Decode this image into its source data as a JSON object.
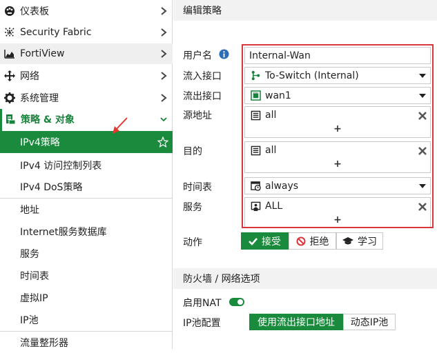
{
  "sidebar": {
    "items": [
      {
        "label": "仪表板"
      },
      {
        "label": "Security Fabric"
      },
      {
        "label": "FortiView"
      },
      {
        "label": "网络"
      },
      {
        "label": "系统管理"
      },
      {
        "label": "策略 & 对象"
      }
    ],
    "sub_items": [
      {
        "label": "IPv4策略"
      },
      {
        "label": "IPv4 访问控制列表"
      },
      {
        "label": "IPv4 DoS策略"
      },
      {
        "label": "地址"
      },
      {
        "label": "Internet服务数据库"
      },
      {
        "label": "服务"
      },
      {
        "label": "时间表"
      },
      {
        "label": "虚拟IP"
      },
      {
        "label": "IP池"
      },
      {
        "label": "流量整形器"
      }
    ]
  },
  "main": {
    "header": "编辑策略",
    "form": {
      "username_label": "用户名",
      "username_value": "Internal-Wan",
      "incoming_label": "流入接口",
      "incoming_value": "To-Switch (Internal)",
      "outgoing_label": "流出接口",
      "outgoing_value": "wan1",
      "source_label": "源地址",
      "source_value": "all",
      "dest_label": "目的",
      "dest_value": "all",
      "schedule_label": "时间表",
      "schedule_value": "always",
      "service_label": "服务",
      "service_value": "ALL",
      "plus": "+",
      "action_label": "动作",
      "actions": [
        "接受",
        "拒绝",
        "学习"
      ]
    },
    "firewall_header": "防火墙 / 网络选项",
    "nat_label": "启用NAT",
    "ippool_label": "IP池配置",
    "ippool_options": [
      "使用流出接口地址",
      "动态IP池"
    ]
  },
  "colors": {
    "accent": "#1a8a3c",
    "highlight_box": "#d9363e",
    "arrow": "#e03a2f"
  }
}
